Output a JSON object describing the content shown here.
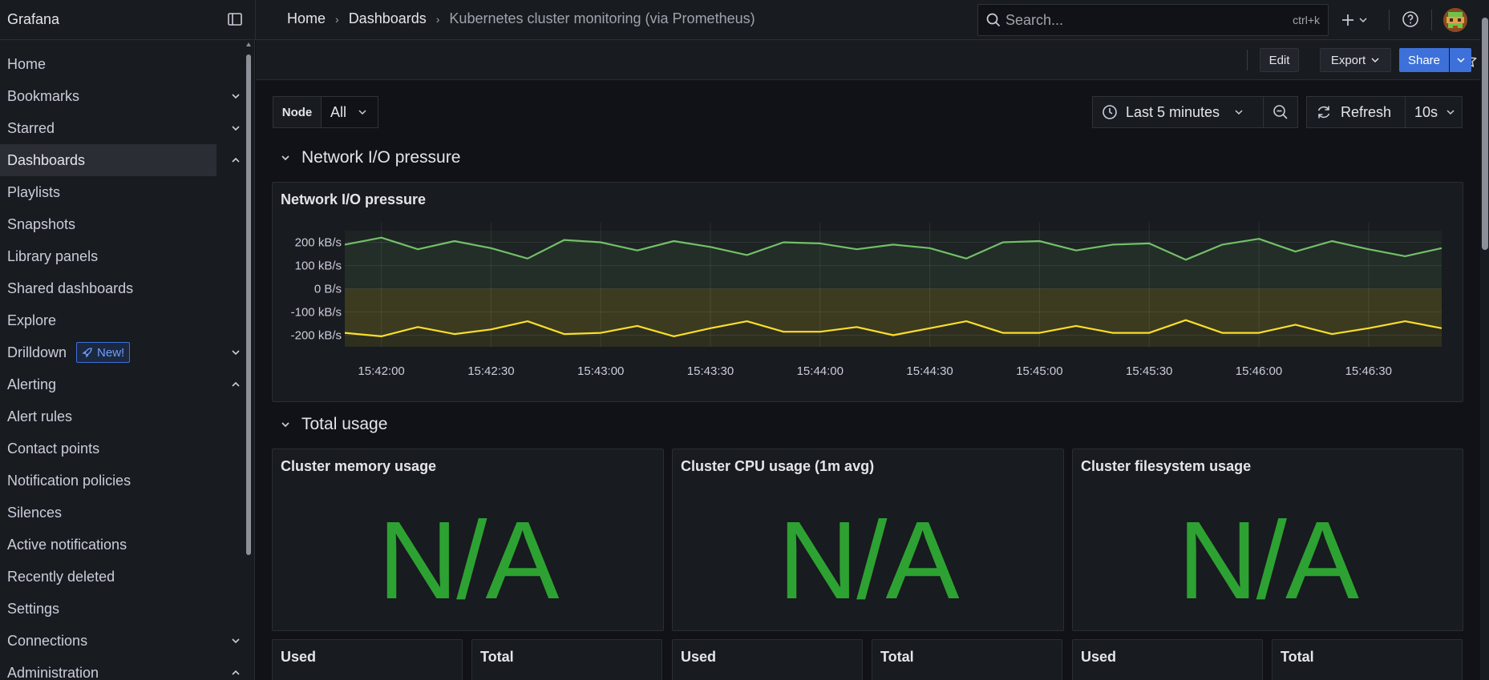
{
  "app": {
    "brand": "Grafana"
  },
  "breadcrumb": [
    "Home",
    "Dashboards",
    "Kubernetes cluster monitoring (via Prometheus)"
  ],
  "search": {
    "placeholder": "Search...",
    "shortcut": "ctrl+k"
  },
  "sidebar": {
    "items": [
      {
        "label": "Home",
        "chevron": ""
      },
      {
        "label": "Bookmarks",
        "chevron": "down"
      },
      {
        "label": "Starred",
        "chevron": "down"
      },
      {
        "label": "Dashboards",
        "chevron": "up",
        "active": true
      },
      {
        "label": "Playlists",
        "chevron": ""
      },
      {
        "label": "Snapshots",
        "chevron": ""
      },
      {
        "label": "Library panels",
        "chevron": ""
      },
      {
        "label": "Shared dashboards",
        "chevron": ""
      },
      {
        "label": "Explore",
        "chevron": ""
      },
      {
        "label": "Drilldown",
        "chevron": "down",
        "badge": "New!"
      },
      {
        "label": "Alerting",
        "chevron": "up"
      },
      {
        "label": "Alert rules",
        "chevron": ""
      },
      {
        "label": "Contact points",
        "chevron": ""
      },
      {
        "label": "Notification policies",
        "chevron": ""
      },
      {
        "label": "Silences",
        "chevron": ""
      },
      {
        "label": "Active notifications",
        "chevron": ""
      },
      {
        "label": "Recently deleted",
        "chevron": ""
      },
      {
        "label": "Settings",
        "chevron": ""
      },
      {
        "label": "Connections",
        "chevron": "down"
      },
      {
        "label": "Administration",
        "chevron": "up"
      }
    ]
  },
  "toolbar": {
    "edit": "Edit",
    "export": "Export",
    "share": "Share"
  },
  "variables": {
    "node_label": "Node",
    "node_value": "All"
  },
  "time": {
    "range": "Last 5 minutes",
    "refresh": "Refresh",
    "interval": "10s"
  },
  "rows": {
    "network": "Network I/O pressure",
    "total": "Total usage"
  },
  "panels": {
    "network_title": "Network I/O pressure",
    "memory_title": "Cluster memory usage",
    "cpu_title": "Cluster CPU usage (1m avg)",
    "fs_title": "Cluster filesystem usage",
    "na": "N/A",
    "used": "Used",
    "total": "Total"
  },
  "colors": {
    "accent": "#3d71d9",
    "received": "#73bf69",
    "transmitted": "#fade2a",
    "stat_green": "#2da232"
  },
  "chart_data": {
    "type": "line",
    "title": "Network I/O pressure",
    "y_unit": "B/s",
    "ylim": [
      -250000,
      250000
    ],
    "y_ticks": [
      "200 kB/s",
      "100 kB/s",
      "0 B/s",
      "-100 kB/s",
      "-200 kB/s"
    ],
    "y_tick_values": [
      200000,
      100000,
      0,
      -100000,
      -200000
    ],
    "x_ticks": [
      "15:42:00",
      "15:42:30",
      "15:43:00",
      "15:43:30",
      "15:44:00",
      "15:44:30",
      "15:45:00",
      "15:45:30",
      "15:46:00",
      "15:46:30"
    ],
    "x": [
      "15:41:50",
      "15:42:00",
      "15:42:10",
      "15:42:20",
      "15:42:30",
      "15:42:40",
      "15:42:50",
      "15:43:00",
      "15:43:10",
      "15:43:20",
      "15:43:30",
      "15:43:40",
      "15:43:50",
      "15:44:00",
      "15:44:10",
      "15:44:20",
      "15:44:30",
      "15:44:40",
      "15:44:50",
      "15:45:00",
      "15:45:10",
      "15:45:20",
      "15:45:30",
      "15:45:40",
      "15:45:50",
      "15:46:00",
      "15:46:10",
      "15:46:20",
      "15:46:30",
      "15:46:40",
      "15:46:50"
    ],
    "series": [
      {
        "values": [
          190000,
          220000,
          170000,
          205000,
          175000,
          130000,
          210000,
          200000,
          165000,
          205000,
          180000,
          145000,
          200000,
          195000,
          170000,
          190000,
          175000,
          130000,
          200000,
          205000,
          165000,
          190000,
          195000,
          125000,
          190000,
          215000,
          160000,
          205000,
          170000,
          140000,
          175000
        ]
      },
      {
        "values": [
          -190000,
          -205000,
          -165000,
          -195000,
          -175000,
          -140000,
          -195000,
          -190000,
          -160000,
          -205000,
          -170000,
          -140000,
          -185000,
          -185000,
          -165000,
          -200000,
          -170000,
          -140000,
          -190000,
          -190000,
          -160000,
          -190000,
          -190000,
          -135000,
          -190000,
          -190000,
          -155000,
          -195000,
          -170000,
          -140000,
          -170000
        ]
      }
    ]
  }
}
